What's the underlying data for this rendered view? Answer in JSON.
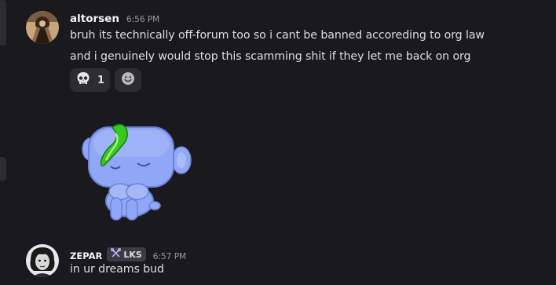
{
  "messages": [
    {
      "username": "altorsen",
      "timestamp": "6:56 PM",
      "lines": [
        "bruh its technically off-forum too so i cant be banned accoreding to org law",
        "and i genuinely would stop this scamming shit if they let me back on org"
      ],
      "reactions": [
        {
          "emoji": "skull-icon",
          "count": "1"
        }
      ]
    },
    {
      "username": "ZEPAR",
      "tag": "LKS",
      "timestamp": "6:57 PM",
      "lines": [
        "in ur dreams bud"
      ]
    }
  ],
  "colors": {
    "background": "#1a1a1e",
    "text": "#dbdee1",
    "username": "#f2f3f5",
    "timestamp": "#949ba4",
    "reaction_bg": "#2b2d31",
    "sticker_body": "#8fa7f5"
  }
}
